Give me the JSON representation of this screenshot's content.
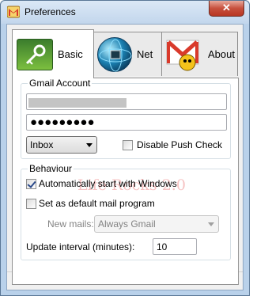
{
  "window": {
    "title": "Preferences",
    "close_label": "✕"
  },
  "tabs": [
    {
      "label": "Basic",
      "icon": "key-icon"
    },
    {
      "label": "Net",
      "icon": "globe-icon"
    },
    {
      "label": "About",
      "icon": "gmail-icon"
    }
  ],
  "gmail_account": {
    "legend": "Gmail Account",
    "email_value": "",
    "password_mask": "●●●●●●●●●",
    "folder_selected": "Inbox",
    "disable_push_label": "Disable Push Check",
    "disable_push_checked": false
  },
  "watermark": "Life Rocks 2.0",
  "behaviour": {
    "legend": "Behaviour",
    "autostart_label": "Automatically start with Windows",
    "autostart_checked": true,
    "default_mail_label": "Set as default mail program",
    "default_mail_checked": false,
    "new_mails_label": "New mails:",
    "new_mails_value": "Always Gmail",
    "update_interval_label": "Update interval (minutes):",
    "update_interval_value": "10"
  },
  "colors": {
    "window_frame": "#b9d1ea",
    "close_button": "#c7503d",
    "panel_bg": "#ffffff"
  }
}
